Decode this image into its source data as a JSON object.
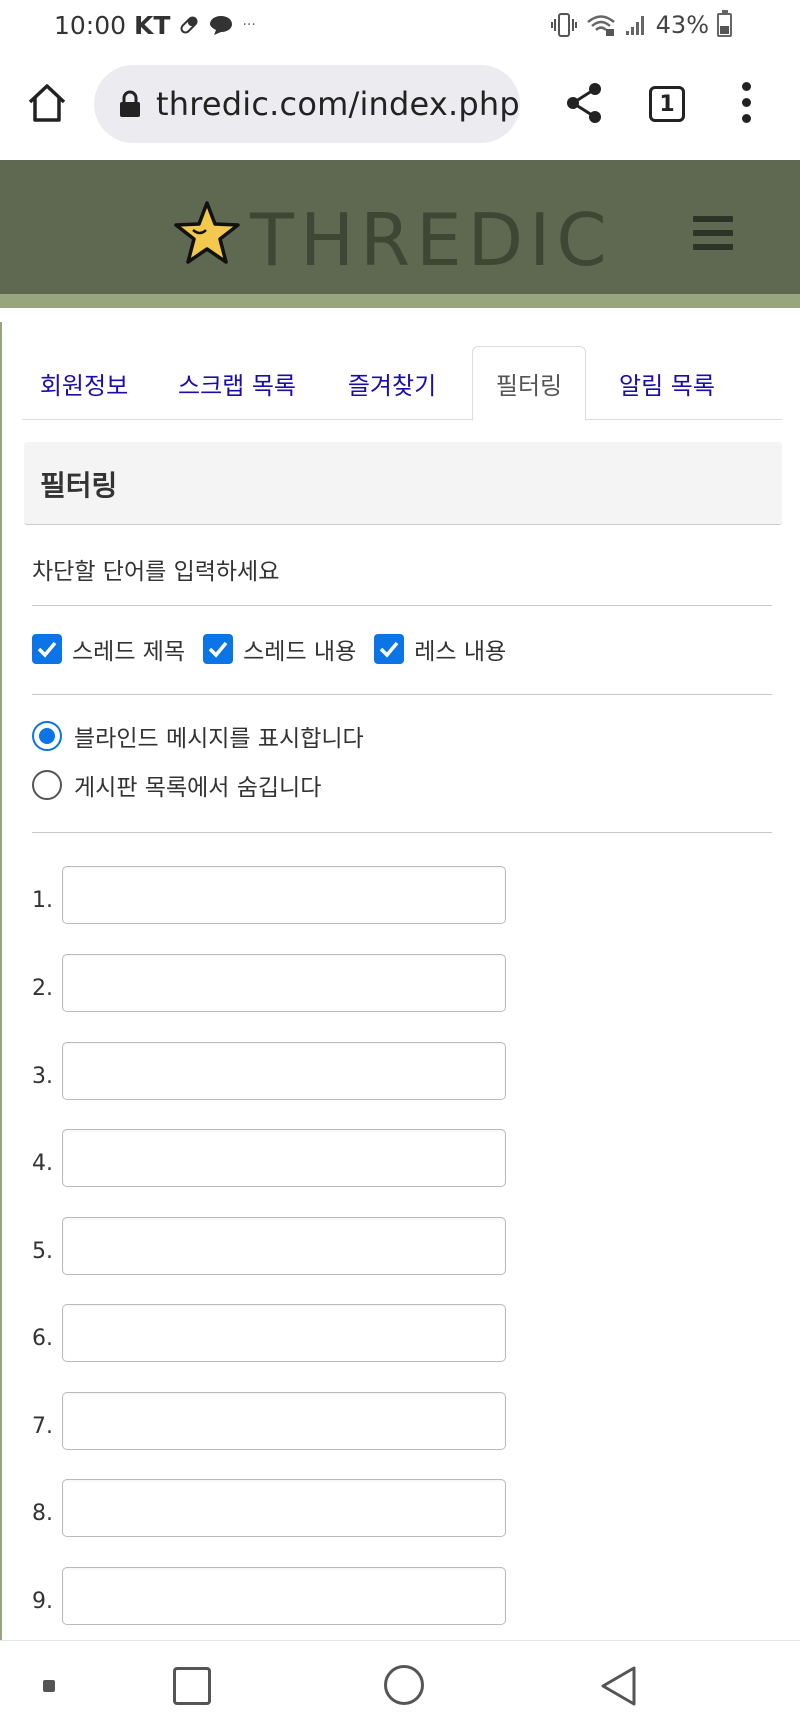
{
  "status_bar": {
    "time": "10:00",
    "carrier": "KT",
    "ellipsis": "···",
    "battery": "43%"
  },
  "browser": {
    "url": "thredic.com/index.php",
    "tab_count": "1"
  },
  "site": {
    "logo_text": "THREDIC"
  },
  "tabs": [
    {
      "label": "회원정보",
      "active": false
    },
    {
      "label": "스크랩 목록",
      "active": false
    },
    {
      "label": "즐겨찾기",
      "active": false
    },
    {
      "label": "필터링",
      "active": true
    },
    {
      "label": "알림 목록",
      "active": false
    }
  ],
  "panel": {
    "title": "필터링",
    "description": "차단할 단어를 입력하세요"
  },
  "filter_targets": [
    {
      "label": "스레드 제목",
      "checked": true
    },
    {
      "label": "스레드 내용",
      "checked": true
    },
    {
      "label": "레스 내용",
      "checked": true
    }
  ],
  "display_options": [
    {
      "label": "블라인드 메시지를 표시합니다",
      "selected": true
    },
    {
      "label": "게시판 목록에서 숨깁니다",
      "selected": false
    }
  ],
  "word_inputs": [
    {
      "number": "1.",
      "value": ""
    },
    {
      "number": "2.",
      "value": ""
    },
    {
      "number": "3.",
      "value": ""
    },
    {
      "number": "4.",
      "value": ""
    },
    {
      "number": "5.",
      "value": ""
    },
    {
      "number": "6.",
      "value": ""
    },
    {
      "number": "7.",
      "value": ""
    },
    {
      "number": "8.",
      "value": ""
    },
    {
      "number": "9.",
      "value": ""
    }
  ],
  "colors": {
    "header_bg": "#5f6952",
    "header_stripe": "#97a67c",
    "logo_text": "#3e4634",
    "tab_link": "#1a0dab",
    "checkbox_blue": "#0b74e6",
    "star_fill": "#f2c94c"
  }
}
